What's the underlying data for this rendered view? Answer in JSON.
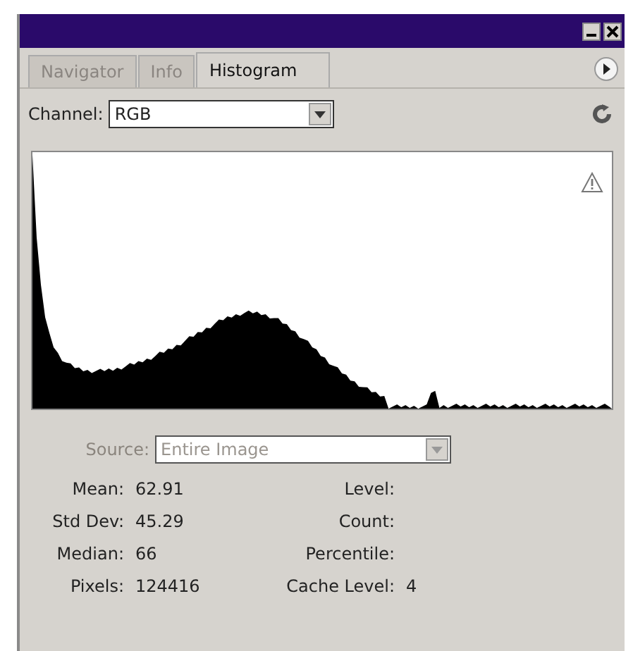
{
  "tabs": [
    {
      "label": "Navigator",
      "selected": false
    },
    {
      "label": "Info",
      "selected": false
    },
    {
      "label": "Histogram",
      "selected": true
    }
  ],
  "channel": {
    "label": "Channel:",
    "value": "RGB"
  },
  "source": {
    "label": "Source:",
    "value": "Entire Image",
    "disabled": true
  },
  "stats_left": [
    {
      "label": "Mean:",
      "value": "62.91"
    },
    {
      "label": "Std Dev:",
      "value": "45.29"
    },
    {
      "label": "Median:",
      "value": "66"
    },
    {
      "label": "Pixels:",
      "value": "124416"
    }
  ],
  "stats_right": [
    {
      "label": "Level:"
    },
    {
      "label": "Count:"
    },
    {
      "label": "Percentile:"
    },
    {
      "label": "Cache Level:",
      "value": "4"
    }
  ]
}
